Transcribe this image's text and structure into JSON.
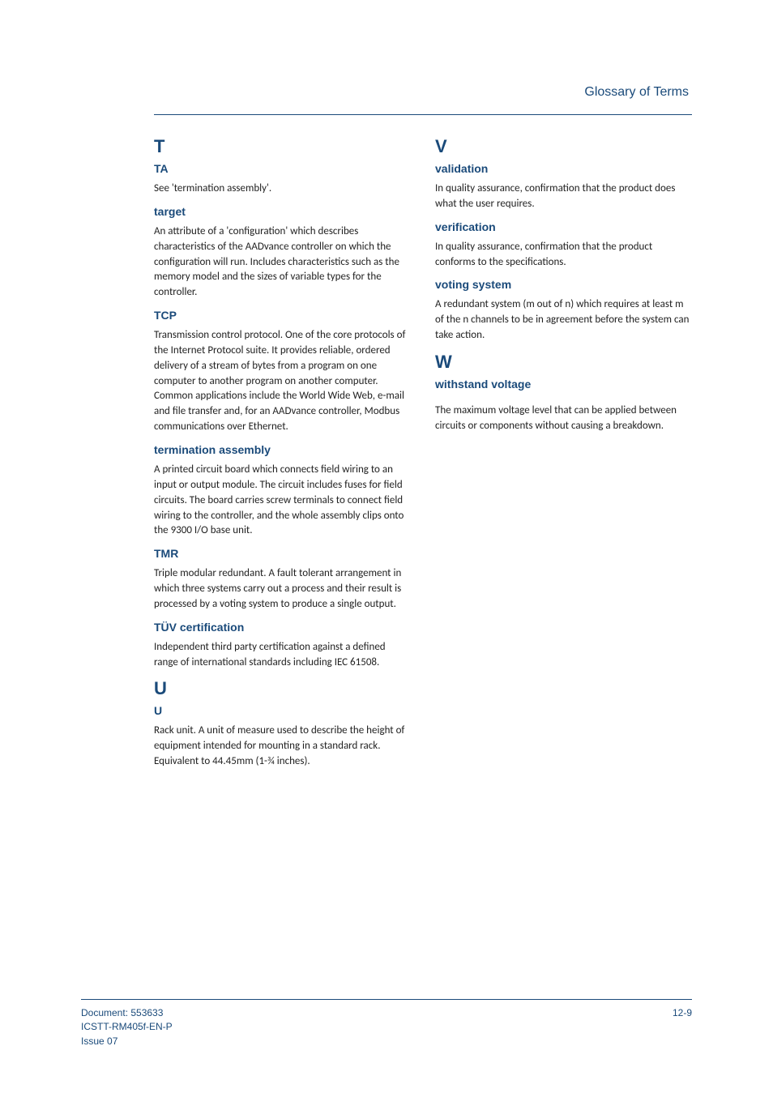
{
  "header": {
    "title": "Glossary of Terms"
  },
  "left": {
    "letterT": "T",
    "ta": {
      "term": "TA",
      "def": "See 'termination assembly'."
    },
    "target": {
      "term": "target",
      "def": "An attribute of a 'configuration' which describes characteristics of the AADvance controller on which the configuration will run. Includes characteristics such as the memory model and the sizes of variable types for the controller."
    },
    "tcp": {
      "term": "TCP",
      "def": "Transmission control protocol. One of the core protocols of the Internet Protocol suite. It provides reliable, ordered delivery of a stream of bytes from a program on one computer to another program on another computer. Common applications include the World Wide Web, e-mail and file transfer and, for an AADvance controller, Modbus communications over Ethernet."
    },
    "termasm": {
      "term": "termination assembly",
      "def": "A printed circuit board which connects field wiring to an input or output module. The circuit includes fuses for field circuits. The board carries screw terminals to connect field wiring to the controller, and the whole assembly clips onto the 9300 I/O base unit."
    },
    "tmr": {
      "term": "TMR",
      "def": "Triple modular redundant. A fault tolerant arrangement in which three systems carry out a process and their result is processed by a voting system to produce a single output."
    },
    "tuv": {
      "term": "TÜV certification",
      "def": "Independent third party certification against a defined range of international standards including IEC 61508."
    },
    "letterU": "U",
    "u": {
      "term": "U",
      "def": "Rack unit. A unit of measure used to describe the height of equipment intended for mounting in a standard rack. Equivalent to 44.45mm (1-¾ inches)."
    }
  },
  "right": {
    "letterV": "V",
    "validation": {
      "term": "validation",
      "def": "In quality assurance, confirmation that the product does what the user requires."
    },
    "verification": {
      "term": "verification",
      "def": "In quality assurance, confirmation that the product conforms to the specifications."
    },
    "voting": {
      "term": "voting system",
      "def": "A redundant system (m out of n) which requires at least m of the n channels to be in agreement before the system can take action."
    },
    "letterW": "W",
    "withstand": {
      "term": "withstand voltage",
      "def": "The maximum voltage level that can be applied between circuits or components without causing a breakdown."
    }
  },
  "footer": {
    "doc": "Document: 553633",
    "code": "ICSTT-RM405f-EN-P",
    "issue": " Issue 07",
    "page": "12-9"
  }
}
